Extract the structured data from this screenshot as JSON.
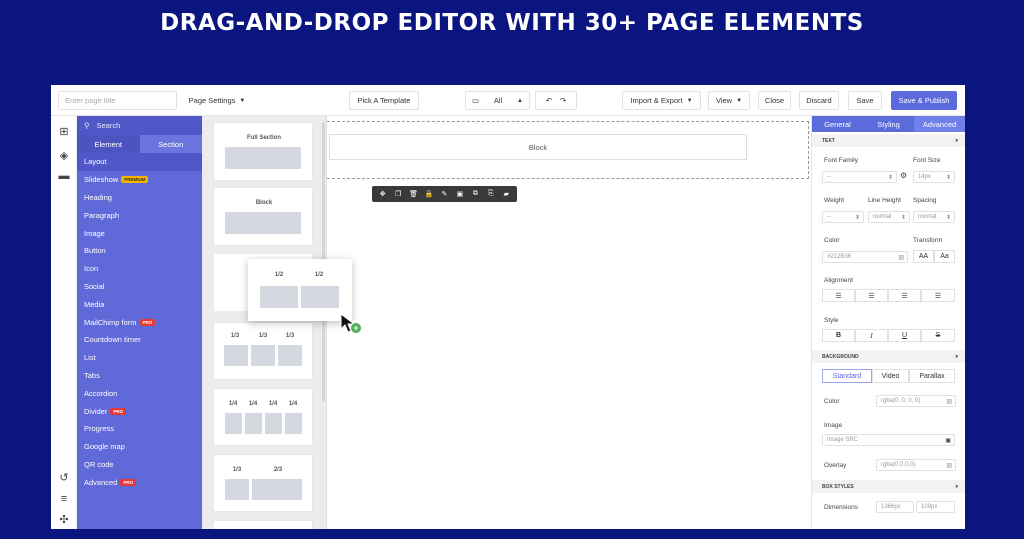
{
  "banner": {
    "title": "DRAG-AND-DROP EDITOR WITH 30+ PAGE ELEMENTS"
  },
  "topbar": {
    "page_title_placeholder": "Enter page title",
    "page_settings": "Page Settings",
    "pick_template": "Pick A Template",
    "device_value": "All",
    "import_export": "Import & Export",
    "view": "View",
    "close": "Close",
    "discard": "Discard",
    "save": "Save",
    "save_publish": "Save & Publish"
  },
  "elements_panel": {
    "search_label": "Search",
    "tabs": [
      "Element",
      "Section"
    ],
    "items": [
      {
        "label": "Layout",
        "badge": ""
      },
      {
        "label": "Slideshow",
        "badge": "PREMIUM"
      },
      {
        "label": "Heading",
        "badge": ""
      },
      {
        "label": "Paragraph",
        "badge": ""
      },
      {
        "label": "Image",
        "badge": ""
      },
      {
        "label": "Button",
        "badge": ""
      },
      {
        "label": "Icon",
        "badge": ""
      },
      {
        "label": "Social",
        "badge": ""
      },
      {
        "label": "Media",
        "badge": ""
      },
      {
        "label": "MailChimp form",
        "badge": "PRO"
      },
      {
        "label": "Countdown timer",
        "badge": ""
      },
      {
        "label": "List",
        "badge": ""
      },
      {
        "label": "Tabs",
        "badge": ""
      },
      {
        "label": "Accordion",
        "badge": ""
      },
      {
        "label": "Divider",
        "badge": "PRO"
      },
      {
        "label": "Progress",
        "badge": ""
      },
      {
        "label": "Google map",
        "badge": ""
      },
      {
        "label": "QR code",
        "badge": ""
      },
      {
        "label": "Advanced",
        "badge": "PRO"
      }
    ]
  },
  "thumbnails": {
    "full_section": "Full Section",
    "block": "Block",
    "half": "1/2",
    "third": "1/3",
    "quarter": "1/4",
    "two_third": "2/3"
  },
  "canvas": {
    "block_label": "Block"
  },
  "properties": {
    "tabs": [
      "General",
      "Styling",
      "Advanced"
    ],
    "text_section": "TEXT",
    "font_family_label": "Font Family",
    "font_family_value": "--",
    "font_size_label": "Font Size",
    "font_size_value": "14px",
    "weight_label": "Weight",
    "weight_value": "--",
    "line_height_label": "Line Height",
    "line_height_value": "normal",
    "spacing_label": "Spacing",
    "spacing_value": "normal",
    "color_label": "Color",
    "color_value": "#212B36",
    "transform_label": "Transform",
    "transform_upper": "AA",
    "transform_cap": "Aa",
    "alignment_label": "Alignment",
    "style_label": "Style",
    "style_bold": "B",
    "style_italic": "I",
    "style_underline": "U",
    "style_strike": "S",
    "background_section": "BACKGROUND",
    "bg_tabs": [
      "Standard",
      "Video",
      "Parallax"
    ],
    "bg_color_label": "Color",
    "bg_color_value": "rgba(0, 0, 0, 0)",
    "image_label": "Image",
    "image_placeholder": "Image SRC",
    "overlay_label": "Overlay",
    "overlay_value": "rgba(0,0,0,0)",
    "box_styles_section": "BOX STYLES",
    "dimensions_label": "Dimensions",
    "dim_w": "1366px",
    "dim_h": "109px"
  },
  "colors": {
    "banner_bg": "#0a1580",
    "accent": "#5b6bdb",
    "panel": "#6069d8"
  }
}
